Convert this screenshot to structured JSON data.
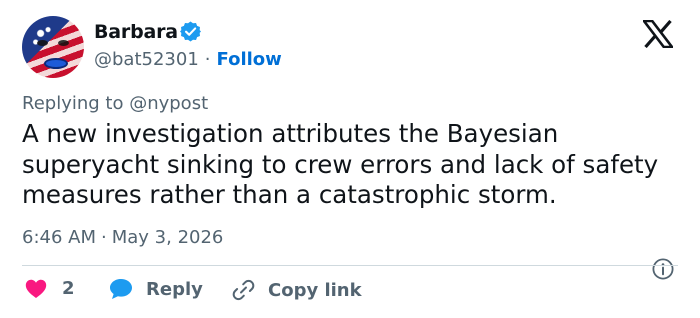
{
  "author": {
    "name": "Barbara",
    "handle": "@bat52301",
    "separator": "·",
    "follow_label": "Follow"
  },
  "replying_to": "Replying to @nypost",
  "tweet": {
    "text": "A new investigation attributes the Bayesian superyacht sinking to crew errors and lack of safety measures rather than a catastrophic storm.",
    "time": "6:46 AM",
    "separator": "·",
    "date": "May 3, 2026"
  },
  "actions": {
    "like_count": "2",
    "reply_label": "Reply",
    "copy_link_label": "Copy link"
  },
  "icons": {
    "verified": "verified-badge-icon",
    "brand": "x-logo-icon",
    "info": "info-icon",
    "like": "heart-icon",
    "reply": "speech-bubble-icon",
    "link": "link-icon"
  },
  "colors": {
    "accent": "#1d9bf0",
    "follow": "#006fd6",
    "heart": "#f91880",
    "secondary_text": "#536471",
    "primary_text": "#0f1419"
  }
}
